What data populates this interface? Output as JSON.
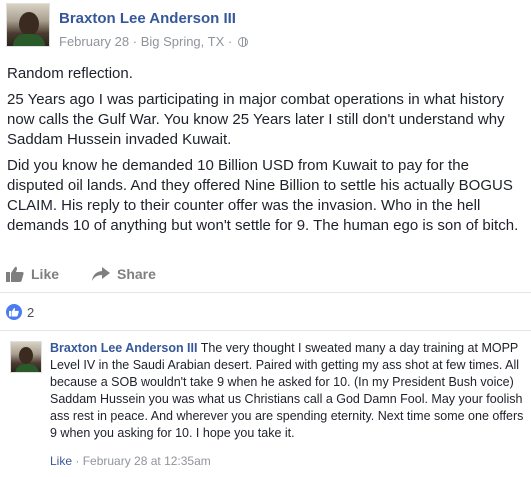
{
  "post": {
    "author": "Braxton Lee Anderson III",
    "date": "February 28",
    "location": "Big Spring, TX",
    "separator": "·",
    "paragraphs": [
      "Random reflection.",
      "25 Years ago I was participating in major combat operations in what history now calls the Gulf War. You know 25 Years later I still don't understand why Saddam Hussein invaded Kuwait.",
      "Did you know he demanded 10 Billion USD from Kuwait to pay for the disputed oil lands. And they offered Nine Billion to settle his actually BOGUS CLAIM. His reply to their counter offer was the invasion. Who in the hell demands 10 of anything but won't settle for 9. The human ego is son of bitch."
    ],
    "privacy_icon": "globe-icon"
  },
  "actions": {
    "like_label": "Like",
    "share_label": "Share",
    "like_icon": "thumbs-up-icon",
    "share_icon": "share-arrow-icon"
  },
  "reactions": {
    "count": "2",
    "icon": "like-reaction-icon",
    "color": "#4d7cf0"
  },
  "comment": {
    "author": "Braxton Lee Anderson III",
    "text": "The very thought I sweated many a day training at MOPP Level IV in the Saudi Arabian desert. Paired with getting my ass shot at few times. All because a SOB wouldn't take 9 when he asked for 10. (In my President Bush voice) Saddam Hussein you was what us Christians call a God Damn Fool. May your foolish ass rest in peace. And wherever you are spending eternity. Next time some one offers 9 when you asking for 10. I hope you take it.",
    "like_label": "Like",
    "separator": "·",
    "timestamp": "February 28 at 12:35am"
  },
  "colors": {
    "link_blue": "#365899",
    "meta_gray": "#90949c",
    "text": "#1d2129"
  }
}
